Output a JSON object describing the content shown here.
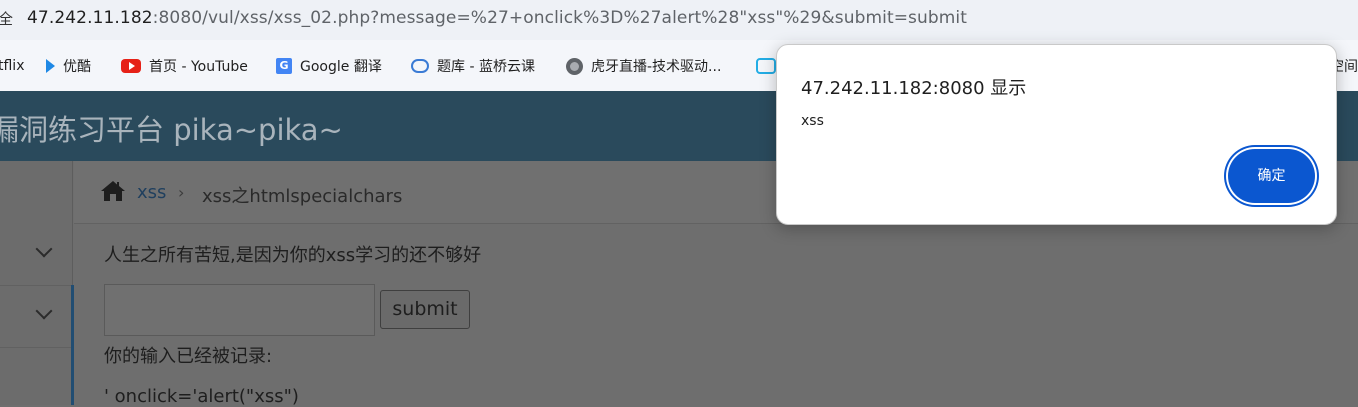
{
  "browser": {
    "url_host": "47.242.11.182",
    "url_rest": ":8080/vul/xss/xss_02.php?message=%27+onclick%3D%27alert%28\"xss\"%29&submit=submit",
    "lock_glyph": "全"
  },
  "bookmarks": [
    {
      "label": "tflix",
      "icon": "netflix-icon"
    },
    {
      "label": "优酷",
      "icon": "youku-icon"
    },
    {
      "label": "首页 - YouTube",
      "icon": "youtube-icon"
    },
    {
      "label": "Google 翻译",
      "icon": "google-translate-icon"
    },
    {
      "label": "题库 - 蓝桥云课",
      "icon": "lanqiao-icon"
    },
    {
      "label": "虎牙直播-技术驱动...",
      "icon": "globe-icon"
    }
  ],
  "bookmarks_overflow_label": "空间",
  "site": {
    "title": "漏洞练习平台 pika~pika~",
    "header_color": "#2a4a5c"
  },
  "breadcrumb": {
    "link": "xss",
    "separator": "›",
    "current": "xss之htmlspecialchars"
  },
  "main": {
    "prompt": "人生之所有苦短,是因为你的xss学习的还不够好",
    "input_value": "",
    "submit_label": "submit",
    "recorded_label": "你的输入已经被记录:",
    "recorded_value": "' onclick='alert(\"xss\")"
  },
  "dialog": {
    "title": "47.242.11.182:8080 显示",
    "message": "xss",
    "ok_label": "确定",
    "accent": "#0b57d0"
  }
}
